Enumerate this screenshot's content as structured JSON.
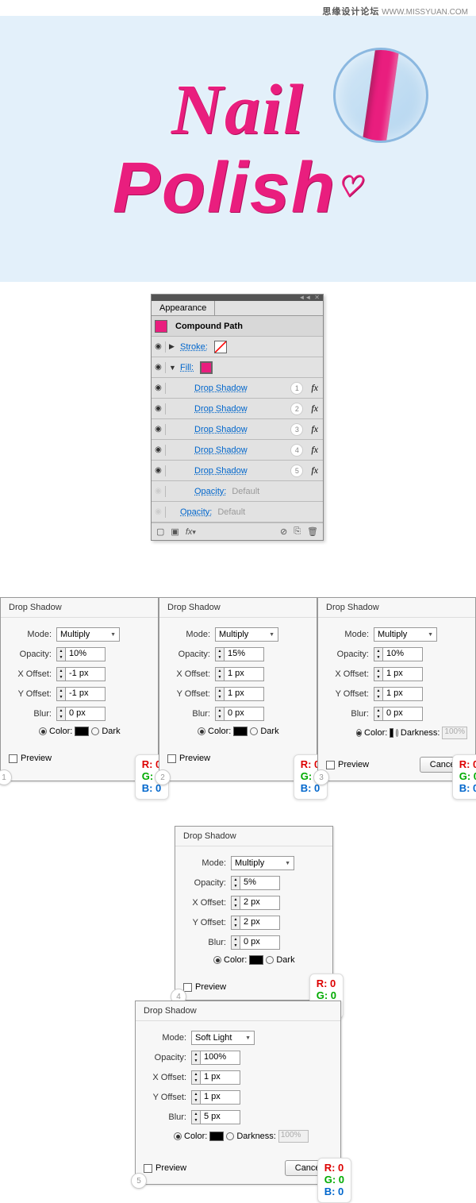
{
  "watermark": {
    "cn": "思缘设计论坛",
    "url": "WWW.MISSYUAN.COM"
  },
  "artwork": {
    "line1": "Nail",
    "line2": "Polish"
  },
  "panel": {
    "title": "Appearance",
    "header": "Compound Path",
    "stroke_label": "Stroke:",
    "fill_label": "Fill:",
    "effects": [
      {
        "label": "Drop Shadow",
        "num": "1"
      },
      {
        "label": "Drop Shadow",
        "num": "2"
      },
      {
        "label": "Drop Shadow",
        "num": "3"
      },
      {
        "label": "Drop Shadow",
        "num": "4"
      },
      {
        "label": "Drop Shadow",
        "num": "5"
      }
    ],
    "opacity_label": "Opacity:",
    "opacity_value": "Default"
  },
  "common": {
    "title": "Drop Shadow",
    "mode_label": "Mode:",
    "opacity_label": "Opacity:",
    "xoff_label": "X Offset:",
    "yoff_label": "Y Offset:",
    "blur_label": "Blur:",
    "color_label": "Color:",
    "dark_label": "Dark",
    "darkness_label": "Darkness:",
    "darkness_value": "100%",
    "preview_label": "Preview",
    "cancel": "Cancel",
    "rgb": {
      "r": "R: 0",
      "g": "G: 0",
      "b": "B: 0"
    }
  },
  "dialogs": [
    {
      "num": "1",
      "mode": "Multiply",
      "opacity": "10%",
      "x": "-1 px",
      "y": "-1 px",
      "blur": "0 px",
      "wide": false
    },
    {
      "num": "2",
      "mode": "Multiply",
      "opacity": "15%",
      "x": "1 px",
      "y": "1 px",
      "blur": "0 px",
      "wide": false
    },
    {
      "num": "3",
      "mode": "Multiply",
      "opacity": "10%",
      "x": "1 px",
      "y": "1 px",
      "blur": "0 px",
      "wide": true
    },
    {
      "num": "4",
      "mode": "Multiply",
      "opacity": "5%",
      "x": "2 px",
      "y": "2 px",
      "blur": "0 px",
      "wide": false
    },
    {
      "num": "5",
      "mode": "Soft Light",
      "opacity": "100%",
      "x": "1 px",
      "y": "1 px",
      "blur": "5 px",
      "wide": true
    }
  ]
}
